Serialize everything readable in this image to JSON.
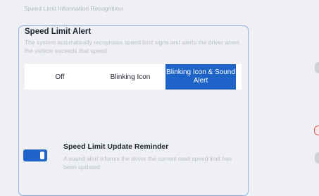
{
  "section_header": "Speed Limit Information Recognition",
  "speed_limit_alert": {
    "title": "Speed Limit Alert",
    "description": "The system automatically recognises speed limit signs and alerts the driver when the vehicle exceeds that speed",
    "options": [
      {
        "label": "Off",
        "selected": false
      },
      {
        "label": "Blinking Icon",
        "selected": false
      },
      {
        "label": "Blinking Icon & Sound Alert",
        "selected": true
      }
    ]
  },
  "speed_limit_update_reminder": {
    "title": "Speed Limit Update Reminder",
    "description": "A sound alert informs the driver the current road speed limit has been updated",
    "toggle_on": true
  },
  "colors": {
    "accent": "#1e63c8",
    "panel_border": "#8fb0df",
    "background": "#eef0f3",
    "muted_text": "#bcc0c7"
  }
}
